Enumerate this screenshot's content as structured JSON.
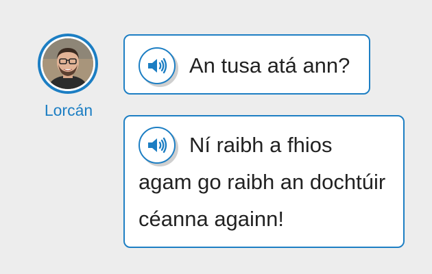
{
  "speaker": {
    "name": "Lorcán",
    "accent_color": "#1c7ec3"
  },
  "messages": [
    {
      "text": "An tusa atá ann?",
      "icon": "speaker-icon"
    },
    {
      "text": "Ní raibh a fhios agam go raibh an dochtúir céanna againn!",
      "icon": "speaker-icon"
    }
  ]
}
